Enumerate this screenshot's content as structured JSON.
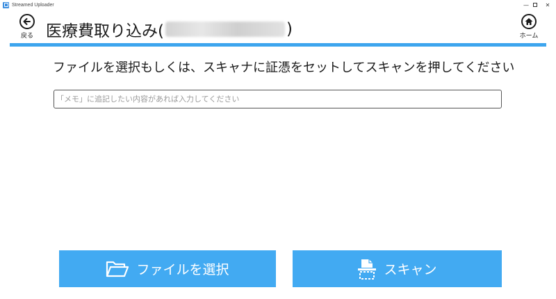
{
  "window": {
    "app_title": "Streamed Uploader",
    "controls": {
      "minimize": "—",
      "close": "✕"
    }
  },
  "nav": {
    "back_label": "戻る",
    "home_label": "ホーム"
  },
  "page": {
    "title_prefix": "医療費取り込み(",
    "title_suffix": ")"
  },
  "instruction": "ファイルを選択もしくは、スキャナに証憑をセットしてスキャンを押してください",
  "memo": {
    "placeholder": "「メモ」に追記したい内容があれば入力してください",
    "value": ""
  },
  "actions": {
    "file_label": "ファイルを選択",
    "scan_label": "スキャン"
  },
  "colors": {
    "accent": "#3da5ee",
    "button": "#42aaf2"
  }
}
